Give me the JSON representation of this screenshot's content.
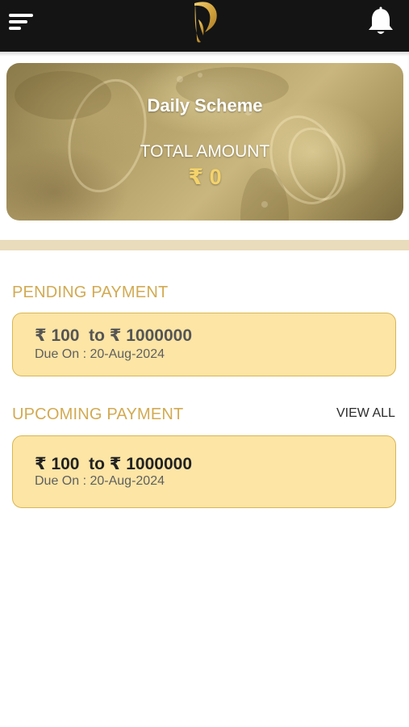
{
  "header": {
    "menu_icon": "menu-icon",
    "logo_icon": "brand-logo",
    "notification_icon": "bell-icon",
    "background_color": "#141414"
  },
  "banner": {
    "title": "Daily Scheme",
    "total_label": "TOTAL AMOUNT",
    "total_value": "₹ 0"
  },
  "pending": {
    "section_title": "PENDING PAYMENT",
    "card": {
      "range": "₹ 100  to ₹ 1000000",
      "due": "Due On : 20-Aug-2024"
    }
  },
  "upcoming": {
    "section_title": "UPCOMING PAYMENT",
    "view_all_label": "VIEW ALL",
    "card": {
      "range": "₹ 100  to ₹ 1000000",
      "due": "Due On : 20-Aug-2024"
    }
  },
  "colors": {
    "accent_gold": "#d2aa52",
    "card_background": "#fce5a5",
    "card_border": "#d9b654",
    "amount_gold": "#f4d36b"
  }
}
